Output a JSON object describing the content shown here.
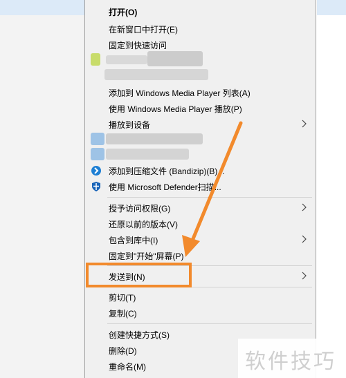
{
  "menu": {
    "items": [
      {
        "label": "打开(O)"
      },
      {
        "label": "在新窗口中打开(E)"
      },
      {
        "label": "固定到快速访问"
      },
      {
        "label": "添加到 Windows Media Player 列表(A)"
      },
      {
        "label": "使用 Windows Media Player 播放(P)"
      },
      {
        "label": "播放到设备"
      },
      {
        "label": "添加到压缩文件 (Bandizip)(B)..."
      },
      {
        "label": "使用 Microsoft Defender扫描..."
      },
      {
        "label": "授予访问权限(G)"
      },
      {
        "label": "还原以前的版本(V)"
      },
      {
        "label": "包含到库中(I)"
      },
      {
        "label": "固定到\"开始\"屏幕(P)"
      },
      {
        "label": "发送到(N)"
      },
      {
        "label": "剪切(T)"
      },
      {
        "label": "复制(C)"
      },
      {
        "label": "创建快捷方式(S)"
      },
      {
        "label": "删除(D)"
      },
      {
        "label": "重命名(M)"
      }
    ],
    "icons": {
      "bandizip": "bandizip-icon",
      "defender": "defender-shield-icon",
      "submenu": "chevron-right-icon"
    }
  },
  "annotation": {
    "highlight_color": "#f28a2c",
    "target_item": "发送到(N)"
  },
  "watermark": {
    "text": "软件技巧"
  }
}
